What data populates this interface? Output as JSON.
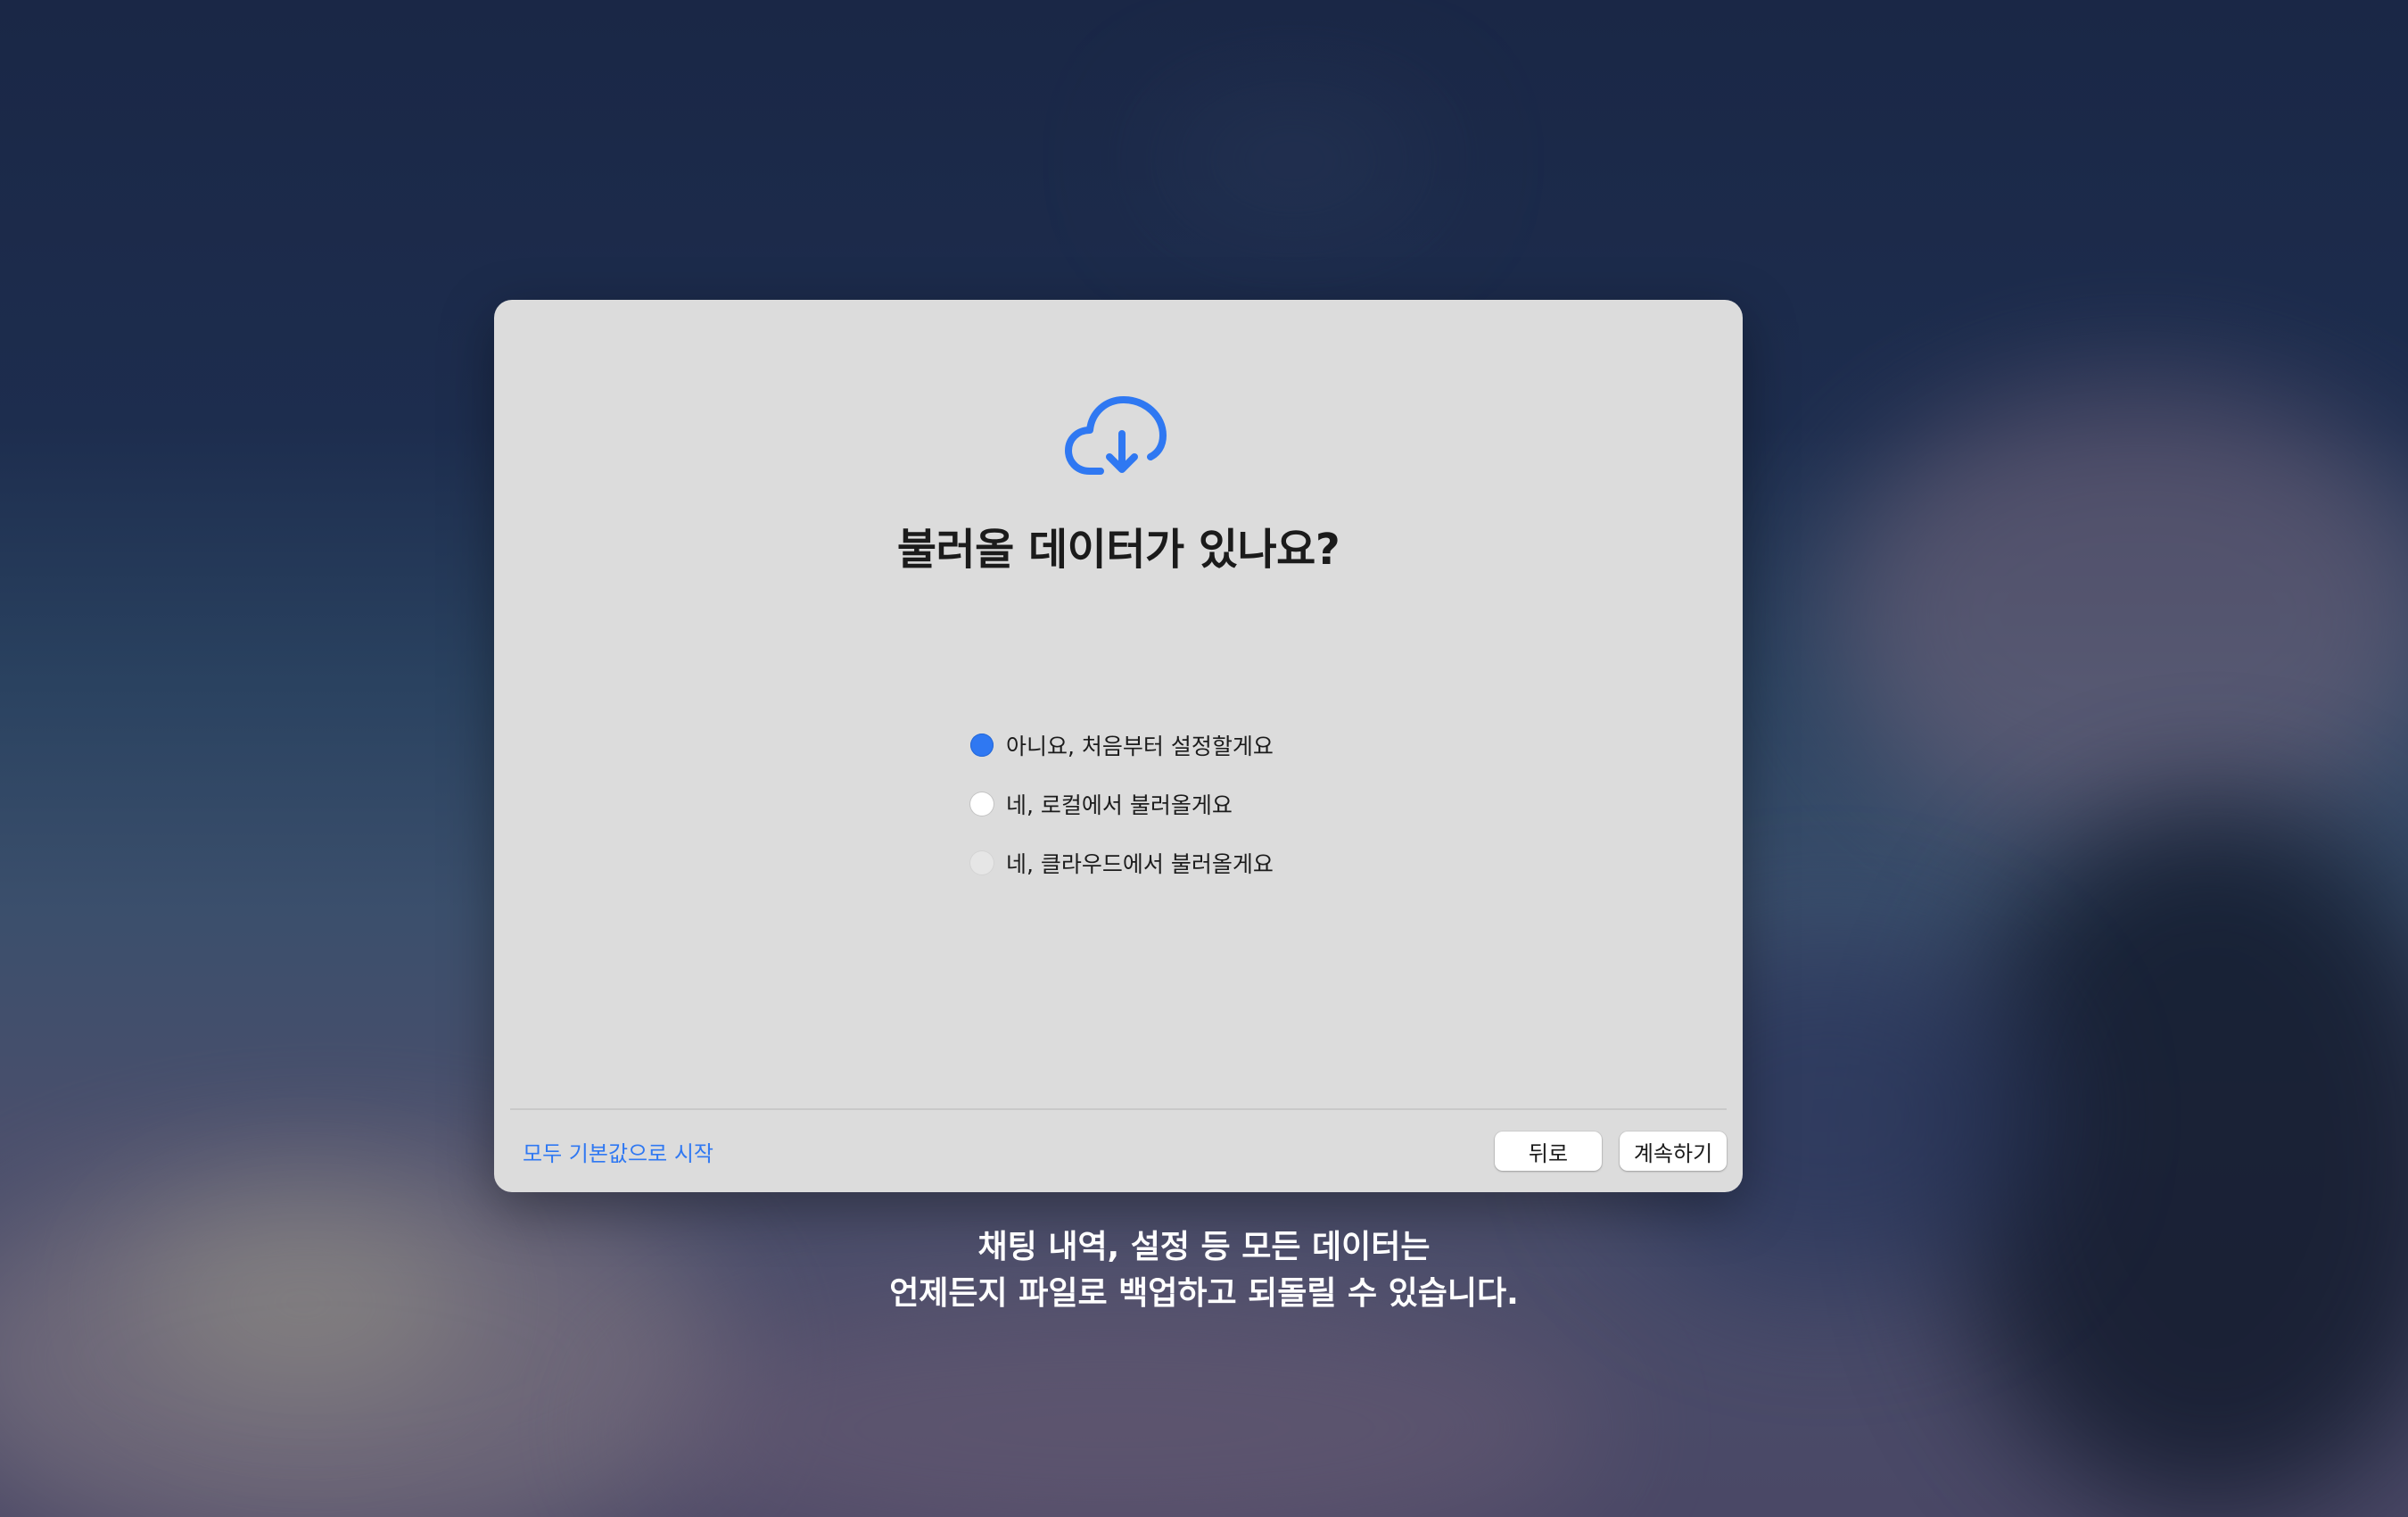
{
  "dialog": {
    "icon": "cloud-download-icon",
    "title": "불러올 데이터가 있나요?",
    "options": [
      {
        "label": "아니요, 처음부터 설정할게요",
        "selected": true
      },
      {
        "label": "네, 로컬에서 불러올게요",
        "selected": false
      },
      {
        "label": "네, 클라우드에서 불러올게요",
        "selected": false
      }
    ],
    "footer": {
      "default_link": "모두 기본값으로 시작",
      "back_label": "뒤로",
      "continue_label": "계속하기"
    }
  },
  "caption": {
    "line1": "채팅 내역, 설정 등 모든 데이터는",
    "line2": "언제든지 파일로 백업하고 되돌릴 수 있습니다."
  },
  "colors": {
    "accent": "#2f78f2",
    "dialog_bg": "#dcdcdc"
  }
}
